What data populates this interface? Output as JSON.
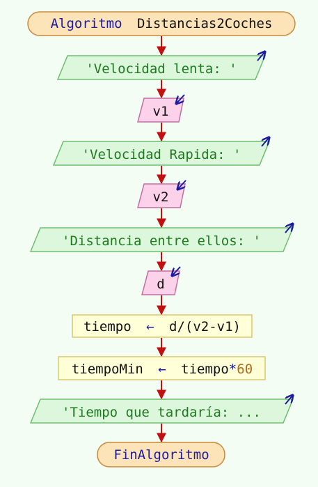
{
  "diagram": {
    "title_keyword": "Algoritmo",
    "title_name": "Distancias2Coches",
    "end_label": "FinAlgoritmo",
    "outputs": [
      "'Velocidad lenta: '",
      "'Velocidad Rapida: '",
      "'Distancia entre ellos: '",
      "'Tiempo que tardaría: ..."
    ],
    "inputs": [
      "v1",
      "v2",
      "d"
    ],
    "assign1": {
      "target": "tiempo",
      "op": "←",
      "expr": "d/(v2-v1)"
    },
    "assign2": {
      "target": "tiempoMin",
      "op": "←",
      "expr_var": "tiempo",
      "expr_op": "*",
      "expr_num": "60"
    },
    "colors": {
      "terminal_fill": "#fde3b8",
      "terminal_stroke": "#c98a3a",
      "output_fill": "#dcf7dc",
      "output_stroke": "#6cbf6c",
      "input_fill": "#fbd2ea",
      "input_stroke": "#c070a0",
      "process_fill": "#ffffd8",
      "process_stroke": "#d8c86a",
      "connector": "#c01010",
      "io_marker": "#1c1ca0"
    }
  }
}
